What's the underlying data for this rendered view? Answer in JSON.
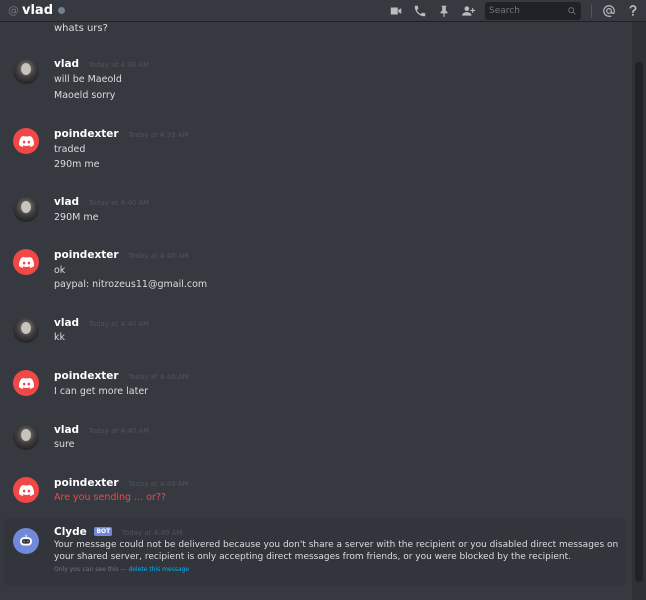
{
  "header": {
    "channel_prefix": "@",
    "channel_name": "vlad",
    "search_placeholder": "Search"
  },
  "cut_text": "whats urs?",
  "messages": [
    {
      "user": "vlad",
      "avatar": "vlad",
      "time": "Today at 4:38 AM",
      "lines": [
        "will be Maeold",
        "Maoeld sorry"
      ]
    },
    {
      "user": "poindexter",
      "avatar": "poindexter",
      "time": "Today at 4:39 AM",
      "lines": [
        "traded",
        "290m me"
      ]
    },
    {
      "user": "vlad",
      "avatar": "vlad",
      "time": "Today at 4:40 AM",
      "lines": [
        "290M me"
      ]
    },
    {
      "user": "poindexter",
      "avatar": "poindexter",
      "time": "Today at 4:40 AM",
      "lines": [
        "ok",
        "paypal: nitrozeus11@gmail.com"
      ]
    },
    {
      "user": "vlad",
      "avatar": "vlad",
      "time": "Today at 4:40 AM",
      "lines": [
        "kk"
      ]
    },
    {
      "user": "poindexter",
      "avatar": "poindexter",
      "time": "Today at 4:40 AM",
      "lines": [
        "I can get more later"
      ]
    },
    {
      "user": "vlad",
      "avatar": "vlad",
      "time": "Today at 4:40 AM",
      "lines": [
        "sure"
      ]
    },
    {
      "user": "poindexter",
      "avatar": "poindexter",
      "time": "Today at 4:49 AM",
      "lines": [
        "Are you sending ... or??"
      ],
      "line_color": "#f04747"
    }
  ],
  "clyde": {
    "name": "Clyde",
    "bot_tag": "BOT",
    "time": "Today at 4:49 AM",
    "text": "Your message could not be delivered because you don't share a server with the recipient or you disabled direct messages on your shared server, recipient is only accepting direct messages from friends, or you were blocked by the recipient.",
    "only_you_prefix": "Only you can see this —",
    "delete_link": "delete this message"
  },
  "colors": {
    "background": "#36393f",
    "poindexter_avatar": "#f04747",
    "clyde_avatar": "#7289da",
    "error_text": "#f04747",
    "link": "#00b0f4"
  }
}
